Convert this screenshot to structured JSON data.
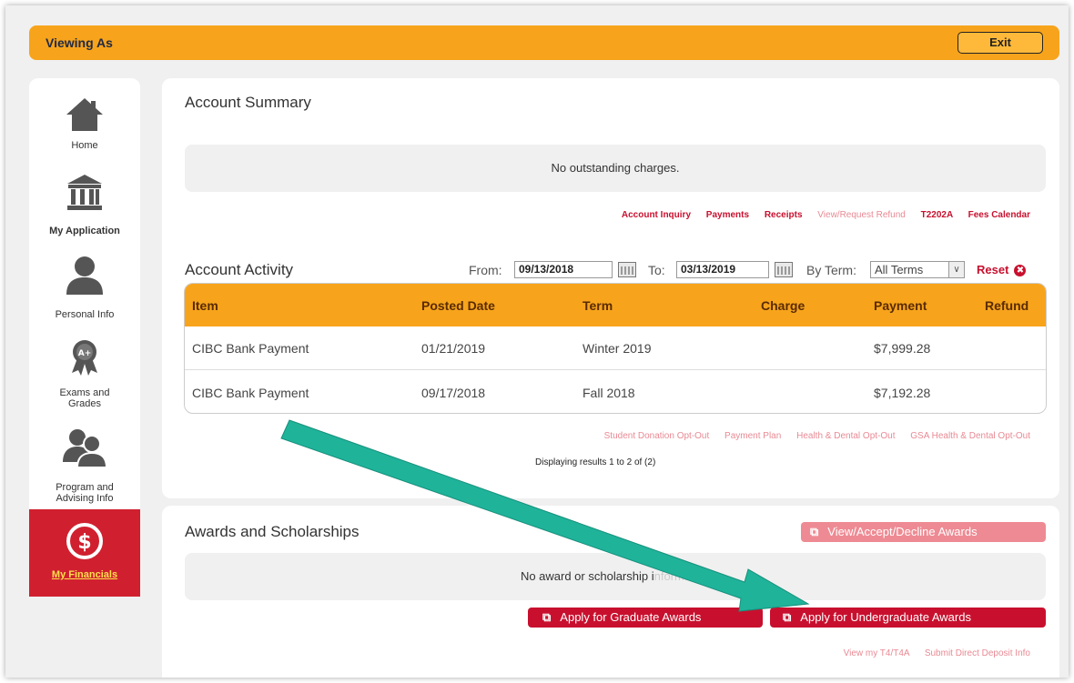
{
  "viewing_bar": {
    "label": "Viewing As",
    "exit_label": "Exit"
  },
  "sidebar": {
    "items": [
      {
        "label": "Home",
        "icon": "home-icon"
      },
      {
        "label": "My Application",
        "icon": "institution-icon"
      },
      {
        "label": "Personal Info",
        "icon": "person-icon"
      },
      {
        "label": "Exams and Grades",
        "icon": "award-ribbon-icon"
      },
      {
        "label": "Program and Advising Info",
        "icon": "people-icon"
      },
      {
        "label": "My Financials",
        "icon": "dollar-icon",
        "active": true
      }
    ]
  },
  "account_summary": {
    "title": "Account Summary",
    "message": "No outstanding charges.",
    "links": [
      {
        "label": "Account Inquiry",
        "style": "red"
      },
      {
        "label": "Payments",
        "style": "red"
      },
      {
        "label": "Receipts",
        "style": "red"
      },
      {
        "label": "View/Request Refund",
        "style": "pale"
      },
      {
        "label": "T2202A",
        "style": "red"
      },
      {
        "label": "Fees Calendar",
        "style": "red"
      }
    ]
  },
  "account_activity": {
    "title": "Account Activity",
    "from_label": "From:",
    "from_value": "09/13/2018",
    "to_label": "To:",
    "to_value": "03/13/2019",
    "term_label": "By Term:",
    "term_value": "All Terms",
    "reset_label": "Reset",
    "columns": [
      "Item",
      "Posted Date",
      "Term",
      "Charge",
      "Payment",
      "Refund"
    ],
    "rows": [
      {
        "item": "CIBC Bank Payment",
        "posted_date": "01/21/2019",
        "term": "Winter 2019",
        "charge": "",
        "payment": "$7,999.28",
        "refund": ""
      },
      {
        "item": "CIBC Bank Payment",
        "posted_date": "09/17/2018",
        "term": "Fall 2018",
        "charge": "",
        "payment": "$7,192.28",
        "refund": ""
      }
    ],
    "links": [
      "Student Donation Opt-Out",
      "Payment Plan",
      "Health & Dental Opt-Out",
      "GSA Health & Dental Opt-Out"
    ],
    "results_text": "Displaying results 1 to 2 of (2)"
  },
  "awards": {
    "title": "Awards and Scholarships",
    "view_button": "View/Accept/Decline Awards",
    "message": "No award or scholarship i",
    "message_faded": "nformation",
    "graduate_button": "Apply for Graduate Awards",
    "undergraduate_button": "Apply for Undergraduate Awards",
    "footer_links": [
      "View my T4/T4A",
      "Submit Direct Deposit Info"
    ]
  },
  "colors": {
    "accent_orange": "#f7a41c",
    "brand_red": "#c8102e",
    "arrow_teal": "#1fb39a"
  }
}
